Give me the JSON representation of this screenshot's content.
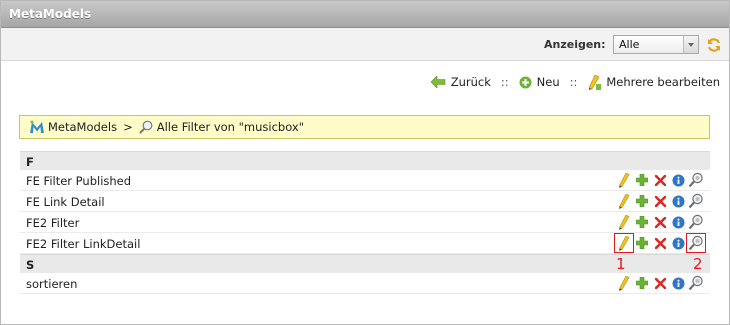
{
  "window": {
    "title": "MetaModels"
  },
  "toolbar": {
    "show_label": "Anzeigen:",
    "show_value": "Alle"
  },
  "actions": {
    "back": "Zurück",
    "separator": "::",
    "new": "Neu",
    "edit_multiple": "Mehrere bearbeiten"
  },
  "breadcrumb": {
    "root": "MetaModels",
    "separator": ">",
    "current": "Alle Filter von \"musicbox\""
  },
  "groups": [
    {
      "label": "F",
      "items": [
        "FE Filter Published",
        "FE Link Detail",
        "FE2 Filter",
        "FE2 Filter LinkDetail"
      ]
    },
    {
      "label": "S",
      "items": [
        "sortieren"
      ]
    }
  ],
  "row_icons": [
    "pencil-icon",
    "plus-icon",
    "delete-icon",
    "info-icon",
    "filter-settings-icon"
  ],
  "annotations": {
    "marker_1": "1",
    "marker_2": "2"
  },
  "colors": {
    "breadcrumb_bg": "#fffcc8",
    "annotation": "#e0191f",
    "titlebar": "#b3b3b3"
  }
}
